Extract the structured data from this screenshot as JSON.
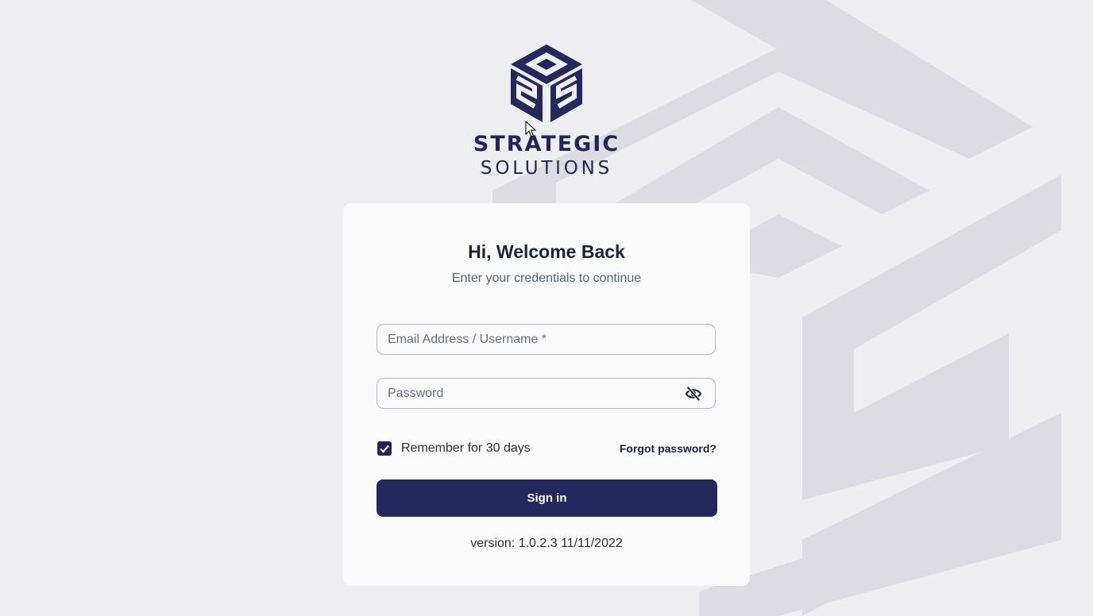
{
  "brand": {
    "line1": "STRATEGIC",
    "line2": "SOLUTIONS",
    "color": "#23255a"
  },
  "login": {
    "title": "Hi, Welcome Back",
    "subtitle": "Enter your credentials to continue",
    "email_placeholder": "Email Address / Username *",
    "password_placeholder": "Password",
    "password_toggle_icon": "eye-off-icon",
    "remember_label": "Remember for 30 days",
    "remember_checked": true,
    "forgot_label": "Forgot password?",
    "signin_label": "Sign in",
    "version": "version: 1.0.2.3 11/11/2022"
  },
  "colors": {
    "primary": "#25285c",
    "background": "#eeeef0",
    "card": "#fafafb"
  }
}
